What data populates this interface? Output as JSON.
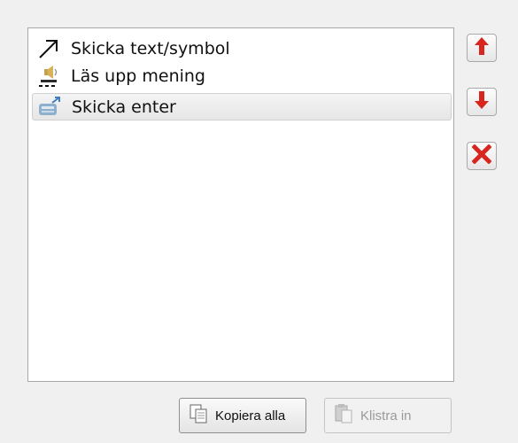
{
  "actions_list": {
    "items": [
      {
        "label": "Skicka text/symbol",
        "icon": "arrow-up-right-icon",
        "selected": false
      },
      {
        "label": "Läs upp mening",
        "icon": "speaker-icon",
        "selected": false
      },
      {
        "label": "Skicka enter",
        "icon": "send-keyboard-icon",
        "selected": true
      }
    ]
  },
  "side_buttons": {
    "move_up_icon": "arrow-up-icon",
    "move_down_icon": "arrow-down-icon",
    "delete_icon": "delete-x-icon",
    "accent_color": "#d8261f"
  },
  "bottom_buttons": {
    "copy_all_label": "Kopiera alla",
    "paste_label": "Klistra in",
    "paste_disabled": true
  }
}
